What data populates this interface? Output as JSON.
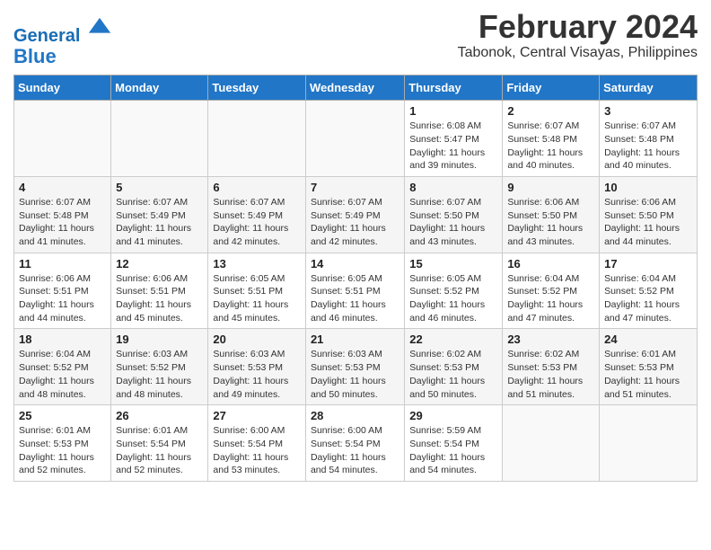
{
  "header": {
    "logo_line1": "General",
    "logo_line2": "Blue",
    "title": "February 2024",
    "subtitle": "Tabonok, Central Visayas, Philippines"
  },
  "days_of_week": [
    "Sunday",
    "Monday",
    "Tuesday",
    "Wednesday",
    "Thursday",
    "Friday",
    "Saturday"
  ],
  "weeks": [
    [
      {
        "day": "",
        "info": ""
      },
      {
        "day": "",
        "info": ""
      },
      {
        "day": "",
        "info": ""
      },
      {
        "day": "",
        "info": ""
      },
      {
        "day": "1",
        "info": "Sunrise: 6:08 AM\nSunset: 5:47 PM\nDaylight: 11 hours and 39 minutes."
      },
      {
        "day": "2",
        "info": "Sunrise: 6:07 AM\nSunset: 5:48 PM\nDaylight: 11 hours and 40 minutes."
      },
      {
        "day": "3",
        "info": "Sunrise: 6:07 AM\nSunset: 5:48 PM\nDaylight: 11 hours and 40 minutes."
      }
    ],
    [
      {
        "day": "4",
        "info": "Sunrise: 6:07 AM\nSunset: 5:48 PM\nDaylight: 11 hours and 41 minutes."
      },
      {
        "day": "5",
        "info": "Sunrise: 6:07 AM\nSunset: 5:49 PM\nDaylight: 11 hours and 41 minutes."
      },
      {
        "day": "6",
        "info": "Sunrise: 6:07 AM\nSunset: 5:49 PM\nDaylight: 11 hours and 42 minutes."
      },
      {
        "day": "7",
        "info": "Sunrise: 6:07 AM\nSunset: 5:49 PM\nDaylight: 11 hours and 42 minutes."
      },
      {
        "day": "8",
        "info": "Sunrise: 6:07 AM\nSunset: 5:50 PM\nDaylight: 11 hours and 43 minutes."
      },
      {
        "day": "9",
        "info": "Sunrise: 6:06 AM\nSunset: 5:50 PM\nDaylight: 11 hours and 43 minutes."
      },
      {
        "day": "10",
        "info": "Sunrise: 6:06 AM\nSunset: 5:50 PM\nDaylight: 11 hours and 44 minutes."
      }
    ],
    [
      {
        "day": "11",
        "info": "Sunrise: 6:06 AM\nSunset: 5:51 PM\nDaylight: 11 hours and 44 minutes."
      },
      {
        "day": "12",
        "info": "Sunrise: 6:06 AM\nSunset: 5:51 PM\nDaylight: 11 hours and 45 minutes."
      },
      {
        "day": "13",
        "info": "Sunrise: 6:05 AM\nSunset: 5:51 PM\nDaylight: 11 hours and 45 minutes."
      },
      {
        "day": "14",
        "info": "Sunrise: 6:05 AM\nSunset: 5:51 PM\nDaylight: 11 hours and 46 minutes."
      },
      {
        "day": "15",
        "info": "Sunrise: 6:05 AM\nSunset: 5:52 PM\nDaylight: 11 hours and 46 minutes."
      },
      {
        "day": "16",
        "info": "Sunrise: 6:04 AM\nSunset: 5:52 PM\nDaylight: 11 hours and 47 minutes."
      },
      {
        "day": "17",
        "info": "Sunrise: 6:04 AM\nSunset: 5:52 PM\nDaylight: 11 hours and 47 minutes."
      }
    ],
    [
      {
        "day": "18",
        "info": "Sunrise: 6:04 AM\nSunset: 5:52 PM\nDaylight: 11 hours and 48 minutes."
      },
      {
        "day": "19",
        "info": "Sunrise: 6:03 AM\nSunset: 5:52 PM\nDaylight: 11 hours and 48 minutes."
      },
      {
        "day": "20",
        "info": "Sunrise: 6:03 AM\nSunset: 5:53 PM\nDaylight: 11 hours and 49 minutes."
      },
      {
        "day": "21",
        "info": "Sunrise: 6:03 AM\nSunset: 5:53 PM\nDaylight: 11 hours and 50 minutes."
      },
      {
        "day": "22",
        "info": "Sunrise: 6:02 AM\nSunset: 5:53 PM\nDaylight: 11 hours and 50 minutes."
      },
      {
        "day": "23",
        "info": "Sunrise: 6:02 AM\nSunset: 5:53 PM\nDaylight: 11 hours and 51 minutes."
      },
      {
        "day": "24",
        "info": "Sunrise: 6:01 AM\nSunset: 5:53 PM\nDaylight: 11 hours and 51 minutes."
      }
    ],
    [
      {
        "day": "25",
        "info": "Sunrise: 6:01 AM\nSunset: 5:53 PM\nDaylight: 11 hours and 52 minutes."
      },
      {
        "day": "26",
        "info": "Sunrise: 6:01 AM\nSunset: 5:54 PM\nDaylight: 11 hours and 52 minutes."
      },
      {
        "day": "27",
        "info": "Sunrise: 6:00 AM\nSunset: 5:54 PM\nDaylight: 11 hours and 53 minutes."
      },
      {
        "day": "28",
        "info": "Sunrise: 6:00 AM\nSunset: 5:54 PM\nDaylight: 11 hours and 54 minutes."
      },
      {
        "day": "29",
        "info": "Sunrise: 5:59 AM\nSunset: 5:54 PM\nDaylight: 11 hours and 54 minutes."
      },
      {
        "day": "",
        "info": ""
      },
      {
        "day": "",
        "info": ""
      }
    ]
  ]
}
